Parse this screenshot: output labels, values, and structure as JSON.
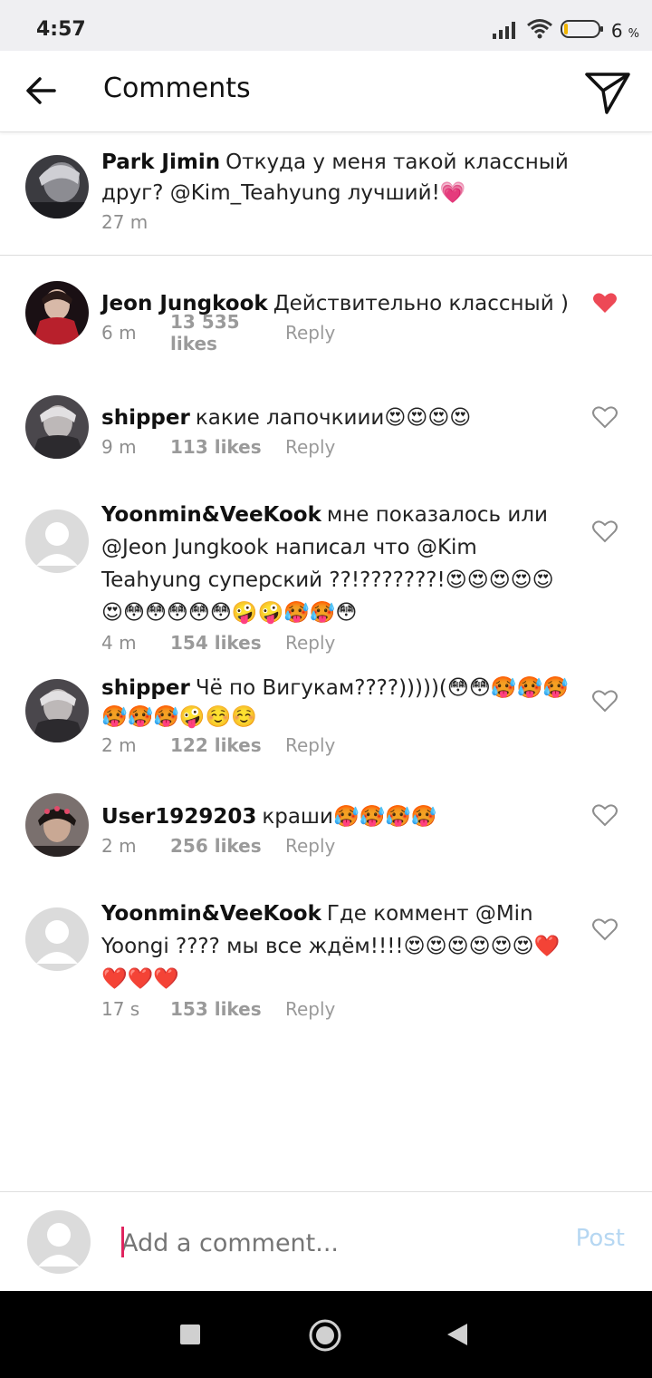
{
  "status": {
    "time": "4:57",
    "battery": "6",
    "battery_unit": "%"
  },
  "header": {
    "title": "Comments"
  },
  "caption": {
    "username": "Park Jimin",
    "text": "Откуда у меня такой классный друг? @Kim_Teahyung лучший!",
    "emoji": "💗",
    "age": "27 m"
  },
  "comments": [
    {
      "username": "Jeon Jungkook",
      "text": "Действительно классный )",
      "emoji": "",
      "age": "6 m",
      "likes": "13 535 likes",
      "reply": "Reply",
      "liked": true
    },
    {
      "username": "shipper",
      "text": "какие лапочкиии",
      "emoji": "😍😍😍😍",
      "age": "9 m",
      "likes": "113 likes",
      "reply": "Reply",
      "liked": false
    },
    {
      "username": "Yoonmin&VeeKook",
      "text": "мне показалось или @Jeon Jungkook написал что @Kim Teahyung суперский ??!???????!",
      "emoji": "😍😍😍😍😍😍😳😳😳😳😳🤪🤪🥵🥵😳",
      "age": "4 m",
      "likes": "154 likes",
      "reply": "Reply",
      "liked": false
    },
    {
      "username": "shipper",
      "text": "Чё по Вигукам????)))))(",
      "emoji": "😳😳🥵🥵🥵🥵🥵🥵🤪☺️☺️",
      "age": "2 m",
      "likes": "122 likes",
      "reply": "Reply",
      "liked": false
    },
    {
      "username": "User1929203",
      "text": "краши",
      "emoji": "🥵🥵🥵🥵",
      "age": "2 m",
      "likes": "256 likes",
      "reply": "Reply",
      "liked": false
    },
    {
      "username": "Yoonmin&VeeKook",
      "text": "Где коммент @Min Yoongi ???? мы все ждём!!!!",
      "emoji": "😍😍😍😍😍😍❤️❤️❤️❤️",
      "age": "17 s",
      "likes": "153 likes",
      "reply": "Reply",
      "liked": false
    }
  ],
  "compose": {
    "placeholder": "Add a comment...",
    "post_label": "Post"
  },
  "icons": {
    "back": "arrow-left-icon",
    "send": "paper-plane-icon",
    "heart": "heart-icon",
    "nav_recents": "square-icon",
    "nav_home": "circle-icon",
    "nav_back": "triangle-icon"
  },
  "colors": {
    "liked_heart": "#ed4956",
    "post_disabled": "#b6d7f2",
    "caret": "#e0245e",
    "status_bar": "#efeff2"
  }
}
